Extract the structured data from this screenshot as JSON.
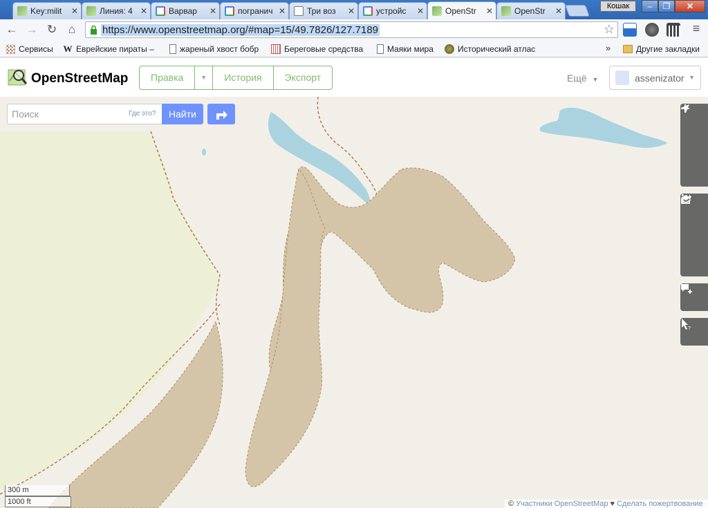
{
  "browser": {
    "tabs": [
      {
        "title": "Key:milit",
        "favicon": "osm"
      },
      {
        "title": "Линия: 4",
        "favicon": "osm"
      },
      {
        "title": "Варвар",
        "favicon": "google"
      },
      {
        "title": "погранич",
        "favicon": "google"
      },
      {
        "title": "Три воз",
        "favicon": "doc"
      },
      {
        "title": "устройс",
        "favicon": "google"
      },
      {
        "title": "OpenStr",
        "favicon": "osm",
        "active": true
      },
      {
        "title": "OpenStr",
        "favicon": "osm"
      }
    ],
    "tab_close": "✕",
    "user_chip": "Кошак",
    "window_buttons": {
      "minimize": "–",
      "maximize": "❐",
      "close": "✕"
    },
    "url": "https://www.openstreetmap.org/#map=15/49.7826/127.7189",
    "bookmarks": [
      {
        "label": "Сервисы",
        "icon": "apps-icon"
      },
      {
        "label": "Еврейские пираты –",
        "icon": "wikipedia-icon"
      },
      {
        "label": "жареный хвост бобр",
        "icon": "page-icon"
      },
      {
        "label": "Береговые средства",
        "icon": "grid-icon"
      },
      {
        "label": "Маяки мира",
        "icon": "page-icon"
      },
      {
        "label": "Исторический атлас",
        "icon": "globe-icon"
      }
    ],
    "bookmarks_overflow": "»",
    "other_bookmarks": "Другие закладки"
  },
  "osm": {
    "brand": "OpenStreetMap",
    "edit": "Правка",
    "history": "История",
    "export": "Экспорт",
    "more": "Ещё",
    "username": "assenizator",
    "search_placeholder": "Поиск",
    "where_link": "Где это?",
    "search_button": "Найти",
    "map_controls": [
      "zoom-in-icon",
      "zoom-out-icon",
      "locate-icon",
      "layers-icon",
      "info-icon",
      "share-icon",
      "note-icon",
      "query-icon"
    ],
    "scale_metric": "300 m",
    "scale_imperial": "1000 ft",
    "attribution_prefix": "©",
    "attribution_link": "Участники OpenStreetMap",
    "attribution_heart": "♥",
    "attribution_donate": "Сделать пожертвование"
  },
  "colors": {
    "osm_green": "#7ebc6f",
    "search_blue": "#7092ff",
    "map_background": "#f2efe9",
    "water": "#aad3df",
    "sand_area": "#d4c4a8",
    "grassland": "#edf0d6",
    "boundary": "#b07c50"
  }
}
